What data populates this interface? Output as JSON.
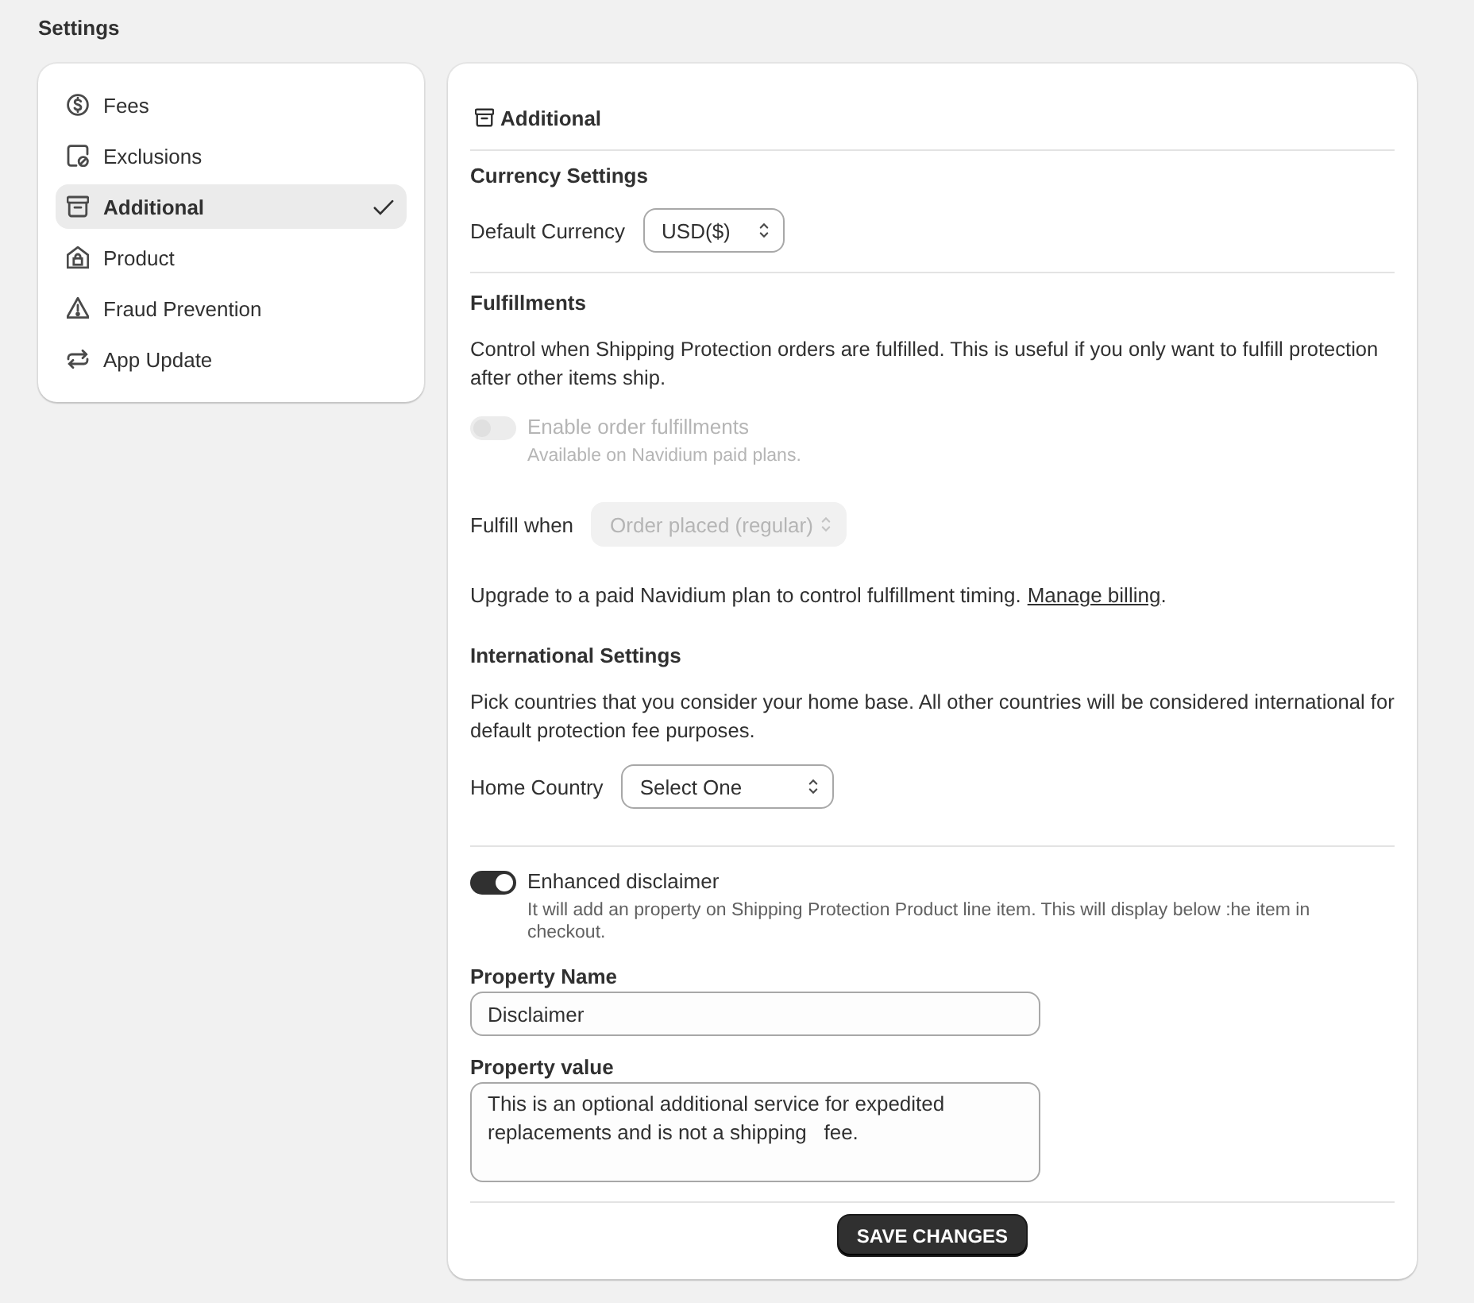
{
  "page": {
    "title": "Settings"
  },
  "sidebar": {
    "items": [
      {
        "label": "Fees",
        "selected": false
      },
      {
        "label": "Exclusions",
        "selected": false
      },
      {
        "label": "Additional",
        "selected": true
      },
      {
        "label": "Product",
        "selected": false
      },
      {
        "label": "Fraud Prevention",
        "selected": false
      },
      {
        "label": "App Update",
        "selected": false
      }
    ]
  },
  "panel": {
    "title": "Additional",
    "currency_settings": {
      "heading": "Currency Settings",
      "select": {
        "label": "Default Currency",
        "value": "USD($)",
        "disabled": false
      }
    },
    "fulfillments": {
      "heading": "Fulfillments",
      "description": "Control when Shipping Protection orders are fulfilled. This is useful if you only want to fulfill protection after other items ship.",
      "toggle": {
        "label": "Enable order fulfillments",
        "help": "Available on Navidium paid plans.",
        "on": false,
        "disabled": true
      },
      "select": {
        "label": "Fulfill when",
        "value": "Order placed (regular)",
        "disabled": true
      },
      "note": {
        "text": "Upgrade to a paid Navidium plan to control fulfillment timing.",
        "link": "Manage billing",
        "end": "."
      }
    },
    "international_settings": {
      "heading": "International Settings",
      "description": "Pick countries that you consider your home base. All other countries will be considered international for default protection fee purposes.",
      "select": {
        "label": "Home Country",
        "value": "Select One",
        "disabled": false
      }
    },
    "disclaimer": {
      "toggle": {
        "label": "Enhanced disclaimer",
        "help": "It will add an property on Shipping Protection Product line item. This will display below :he item in checkout.",
        "on": true,
        "disabled": false
      },
      "property_name": {
        "label": "Property Name",
        "value": "Disclaimer"
      },
      "property_value": {
        "label": "Property value",
        "value": "This is an optional additional service for expedited replacements and is not a shipping   fee."
      }
    },
    "save_button": {
      "label": "SAVE CHANGES"
    }
  }
}
